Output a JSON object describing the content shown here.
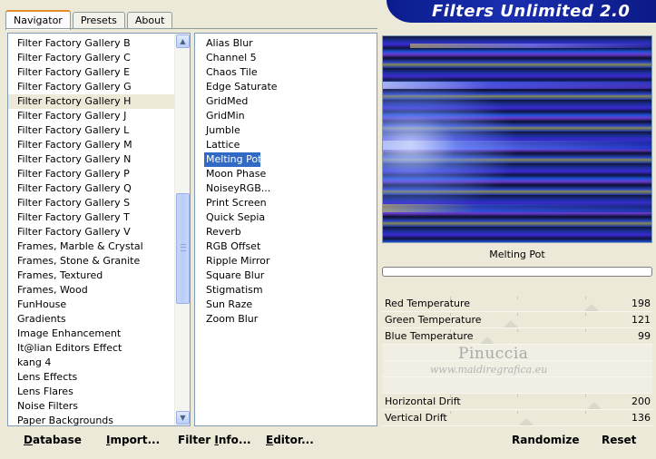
{
  "tabs": [
    {
      "label": "Navigator",
      "active": true
    },
    {
      "label": "Presets",
      "active": false
    },
    {
      "label": "About",
      "active": false
    }
  ],
  "app_title": "Filters Unlimited 2.0",
  "categories": [
    "Filter Factory Gallery B",
    "Filter Factory Gallery C",
    "Filter Factory Gallery E",
    "Filter Factory Gallery G",
    "Filter Factory Gallery H",
    "Filter Factory Gallery J",
    "Filter Factory Gallery L",
    "Filter Factory Gallery M",
    "Filter Factory Gallery N",
    "Filter Factory Gallery P",
    "Filter Factory Gallery Q",
    "Filter Factory Gallery S",
    "Filter Factory Gallery T",
    "Filter Factory Gallery V",
    "Frames, Marble & Crystal",
    "Frames, Stone & Granite",
    "Frames, Textured",
    "Frames, Wood",
    "FunHouse",
    "Gradients",
    "Image Enhancement",
    "It@lian Editors Effect",
    "kang 4",
    "Lens Effects",
    "Lens Flares",
    "Noise Filters",
    "Paper Backgrounds"
  ],
  "selected_category": "Filter Factory Gallery H",
  "filters": [
    "Alias Blur",
    "Channel 5",
    "Chaos Tile",
    "Edge Saturate",
    "GridMed",
    "GridMin",
    "Jumble",
    "Lattice",
    "Melting Pot",
    "Moon Phase",
    "NoiseyRGB...",
    "Print Screen",
    "Quick Sepia",
    "Reverb",
    "RGB Offset",
    "Ripple Mirror",
    "Square Blur",
    "Stigmatism",
    "Sun Raze",
    "Zoom Blur"
  ],
  "selected_filter": "Melting Pot",
  "current_filter_name": "Melting Pot",
  "sliders": [
    {
      "label": "Red Temperature",
      "value": "198",
      "fraction": 0.776
    },
    {
      "label": "Green Temperature",
      "value": "121",
      "fraction": 0.475
    },
    {
      "label": "Blue Temperature",
      "value": "99",
      "fraction": 0.388
    },
    {
      "label": "",
      "value": ""
    },
    {
      "label": "",
      "value": ""
    },
    {
      "label": "",
      "value": ""
    },
    {
      "label": "Horizontal Drift",
      "value": "200",
      "fraction": 0.784
    },
    {
      "label": "Vertical Drift",
      "value": "136",
      "fraction": 0.533
    }
  ],
  "watermark": {
    "line1": "Pinuccia",
    "line2": "www.maidiregrafica.eu"
  },
  "bottom_buttons": {
    "database": {
      "u": "D",
      "rest": "atabase"
    },
    "import": {
      "u": "I",
      "rest": "mport..."
    },
    "filter_info": {
      "pre": "Filter ",
      "u": "I",
      "rest": "nfo..."
    },
    "editor": {
      "u": "E",
      "rest": "ditor..."
    },
    "randomize": "Randomize",
    "reset": "Reset"
  },
  "colors": {
    "selection": "#316AC5",
    "banner": "#0A1C8C",
    "dialog": "#ECE9D8"
  }
}
